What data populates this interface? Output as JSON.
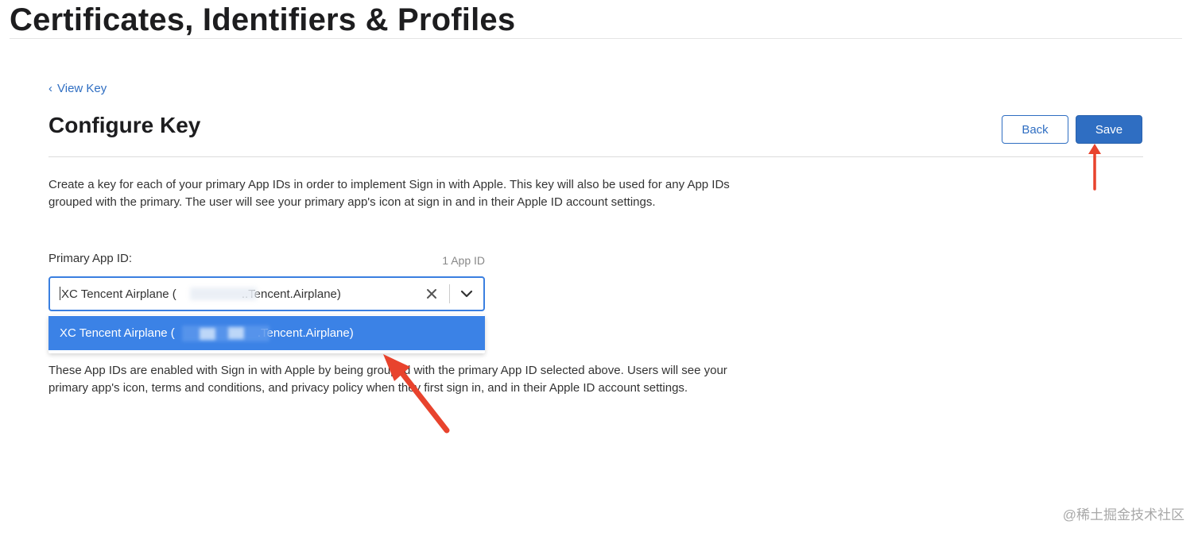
{
  "header": {
    "title": "Certificates, Identifiers & Profiles"
  },
  "breadcrumb": {
    "chevron": "‹",
    "label": "View Key"
  },
  "page": {
    "title": "Configure Key",
    "back_label": "Back",
    "save_label": "Save",
    "description": "Create a key for each of your primary App IDs in order to implement Sign in with Apple. This key will also be used for any App IDs grouped with the primary. The user will see your primary app's icon at sign in and in their Apple ID account settings."
  },
  "primary_app_id": {
    "label": "Primary App ID:",
    "count": "1 App ID",
    "value_prefix": "XC Tencent Airplane (",
    "value_suffix": "..Tencent.Airplane)",
    "clear_icon": "close-icon",
    "toggle_icon": "chevron-down-icon",
    "options": [
      {
        "prefix": "XC Tencent Airplane (",
        "suffix": ".Tencent.Airplane)",
        "selected": true
      }
    ]
  },
  "grouped": {
    "description": "These App IDs are enabled with Sign in with Apple by being grouped with the primary App ID selected above. Users will see your primary app's icon, terms and conditions, and privacy policy when they first sign in, and in their Apple ID account settings."
  },
  "annotations": {
    "arrow_color": "#e8432d"
  },
  "watermark": "@稀土掘金技术社区",
  "colors": {
    "link": "#2f6ec2",
    "primary_button": "#2f6ec2",
    "focus_border": "#3a7fe0",
    "selected_option": "#3b82e6"
  }
}
